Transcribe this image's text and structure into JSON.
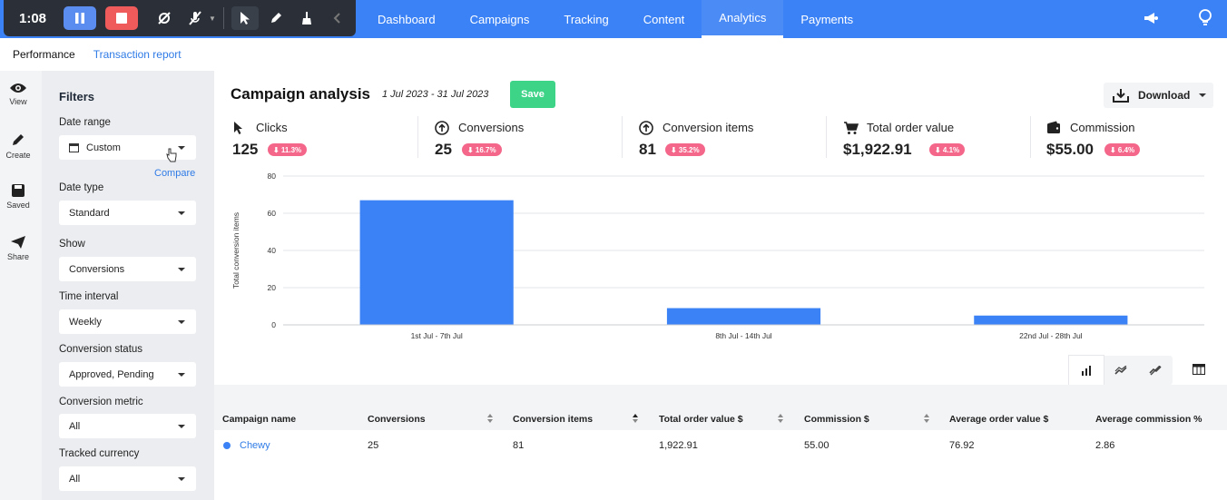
{
  "recorder": {
    "time": "1:08"
  },
  "nav": {
    "tabs": [
      "Dashboard",
      "Campaigns",
      "Tracking",
      "Content",
      "Analytics",
      "Payments"
    ],
    "active": "Analytics"
  },
  "subnav": {
    "performance": "Performance",
    "transaction_report": "Transaction report"
  },
  "rail": {
    "view": "View",
    "create": "Create",
    "saved": "Saved",
    "share": "Share"
  },
  "filters": {
    "title": "Filters",
    "date_range_label": "Date range",
    "date_range_value": "Custom",
    "compare": "Compare",
    "date_type_label": "Date type",
    "date_type_value": "Standard",
    "show_label": "Show",
    "show_value": "Conversions",
    "time_interval_label": "Time interval",
    "time_interval_value": "Weekly",
    "conversion_status_label": "Conversion status",
    "conversion_status_value": "Approved, Pending",
    "conversion_metric_label": "Conversion metric",
    "conversion_metric_value": "All",
    "tracked_currency_label": "Tracked currency",
    "tracked_currency_value": "All"
  },
  "main": {
    "title": "Campaign analysis",
    "date_range": "1 Jul 2023 - 31 Jul 2023",
    "save": "Save",
    "download": "Download"
  },
  "kpis": [
    {
      "label": "Clicks",
      "value": "125",
      "badge": "⬇ 11.3%"
    },
    {
      "label": "Conversions",
      "value": "25",
      "badge": "⬇ 16.7%"
    },
    {
      "label": "Conversion items",
      "value": "81",
      "badge": "⬇ 35.2%"
    },
    {
      "label": "Total order value",
      "value": "$1,922.91",
      "badge": "⬇ 4.1%"
    },
    {
      "label": "Commission",
      "value": "$55.00",
      "badge": "⬇ 6.4%"
    }
  ],
  "chart_data": {
    "type": "bar",
    "categories": [
      "1st Jul - 7th Jul",
      "8th Jul - 14th Jul",
      "22nd Jul - 28th Jul"
    ],
    "values": [
      67,
      9,
      5
    ],
    "ylabel": "Total conversion items",
    "ylim": [
      0,
      80
    ],
    "yticks": [
      "0",
      "20",
      "40",
      "60",
      "80"
    ],
    "color": "#3b82f6",
    "grid": true
  },
  "table": {
    "headers": [
      "Campaign name",
      "Conversions",
      "Conversion items",
      "Total order value $",
      "Commission $",
      "Average order value $",
      "Average commission %"
    ],
    "rows": [
      [
        "Chewy",
        "25",
        "81",
        "1,922.91",
        "55.00",
        "76.92",
        "2.86"
      ]
    ]
  }
}
